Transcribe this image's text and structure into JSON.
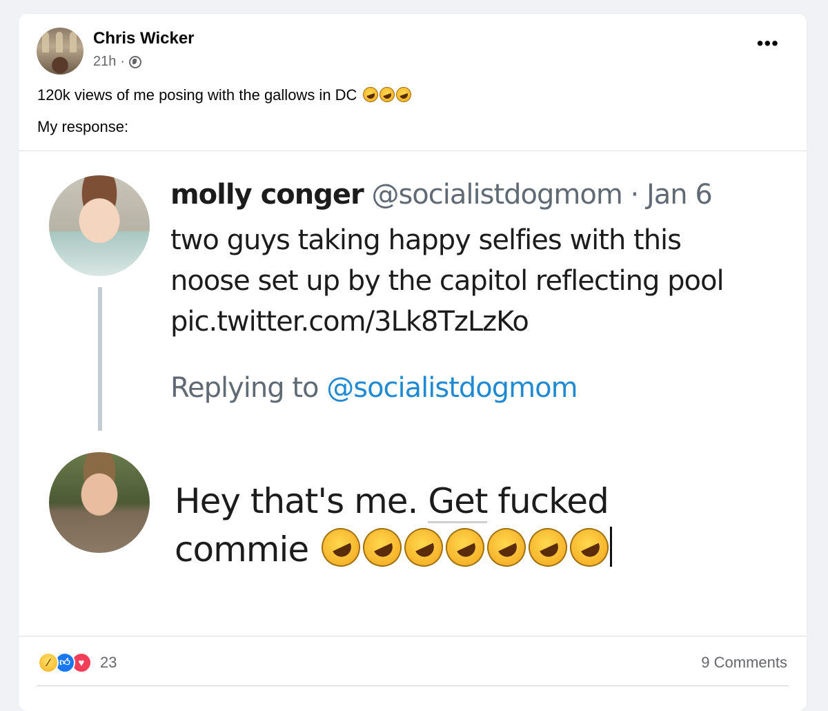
{
  "post": {
    "author": "Chris Wicker",
    "time": "21h",
    "separator": "·",
    "more_label": "•••",
    "text_line1": "120k views of me posing with the gallows in DC",
    "text_line2": "My response:"
  },
  "tweet": {
    "name": "molly conger",
    "handle": "@socialistdogmom",
    "date_sep": "·",
    "date": "Jan 6",
    "lines": [
      "two guys taking happy selfies with this",
      "noose set up by the capitol reflecting pool",
      "pic.twitter.com/3Lk8TzLzKo"
    ],
    "replying_prefix": "Replying to",
    "replying_handle": "@socialistdogmom"
  },
  "reply": {
    "line1_start": "Hey that's me. ",
    "line1_underlined": "Get",
    "line1_end": " fucked",
    "line2": "commie"
  },
  "footer": {
    "reaction_count": "23",
    "comments_label": "9 Comments"
  },
  "icons": {
    "emoji": "rolling-on-floor-laughing",
    "reactions": [
      "haha",
      "like",
      "love"
    ]
  },
  "colors": {
    "link": "#1f8ad2",
    "like": "#1877f2",
    "love": "#f33e58"
  }
}
